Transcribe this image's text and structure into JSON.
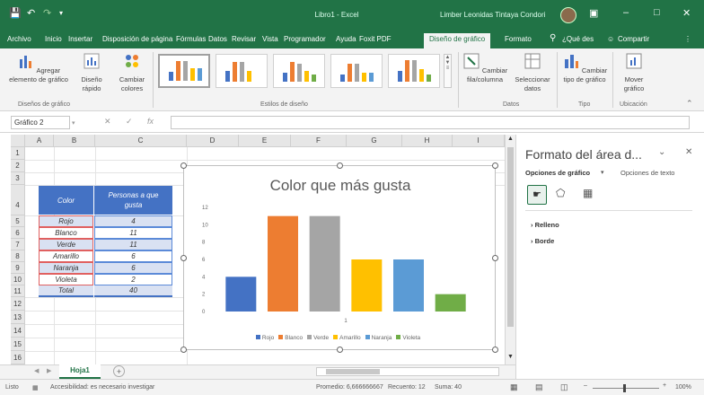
{
  "window": {
    "app_title": "Libro1 - Excel",
    "user_name": "Limber Leonidas Tintaya Condori",
    "minimize_icon": "minimize-icon",
    "restore_icon": "restore-icon",
    "close_icon": "close-icon"
  },
  "menu": {
    "items": [
      "Archivo",
      "Inicio",
      "Insertar",
      "Disposición de página",
      "Fórmulas",
      "Datos",
      "Revisar",
      "Vista",
      "Programador",
      "Ayuda",
      "Foxit PDF",
      "Diseño de gráfico",
      "Formato"
    ],
    "tell_me": "¿Qué des",
    "share": "Compartir"
  },
  "ribbon": {
    "add_element": "Agregar elemento de gráfico",
    "quick_layout": "Diseño rápido",
    "change_colors": "Cambiar colores",
    "group_layouts": "Diseños de gráfico",
    "group_styles": "Estilos de diseño",
    "switch_row_col": "Cambiar fila/columna",
    "select_data": "Seleccionar datos",
    "group_data": "Datos",
    "change_type": "Cambiar tipo de gráfico",
    "group_type": "Tipo",
    "move_chart": "Mover gráfico",
    "group_location": "Ubicación"
  },
  "formula_bar": {
    "name_box": "Gráfico 2",
    "cancel": "✕",
    "confirm": "✓",
    "fx": "fx"
  },
  "sheet": {
    "columns": [
      "A",
      "B",
      "C",
      "D",
      "E",
      "F",
      "G",
      "H",
      "I"
    ],
    "rows": [
      "1",
      "2",
      "3",
      "4",
      "5",
      "6",
      "7",
      "8",
      "9",
      "10",
      "11",
      "12",
      "13",
      "14",
      "15",
      "16"
    ],
    "table": {
      "header_color": "Color",
      "header_count": "Personas a que gusta",
      "rows": [
        {
          "label": "Rojo",
          "value": "4"
        },
        {
          "label": "Blanco",
          "value": "11"
        },
        {
          "label": "Verde",
          "value": "11"
        },
        {
          "label": "Amarillo",
          "value": "6"
        },
        {
          "label": "Naranja",
          "value": "6"
        },
        {
          "label": "Violeta",
          "value": "2"
        }
      ],
      "total_label": "Total",
      "total_value": "40"
    }
  },
  "chart_data": {
    "type": "bar",
    "title": "Color que más gusta",
    "categories": [
      "1"
    ],
    "series": [
      {
        "name": "Rojo",
        "values": [
          4
        ],
        "color": "#4472c4"
      },
      {
        "name": "Blanco",
        "values": [
          11
        ],
        "color": "#ed7d31"
      },
      {
        "name": "Verde",
        "values": [
          11
        ],
        "color": "#a5a5a5"
      },
      {
        "name": "Amarillo",
        "values": [
          6
        ],
        "color": "#ffc000"
      },
      {
        "name": "Naranja",
        "values": [
          6
        ],
        "color": "#5b9bd5"
      },
      {
        "name": "Violeta",
        "values": [
          2
        ],
        "color": "#70ad47"
      }
    ],
    "yticks": [
      "0",
      "2",
      "4",
      "6",
      "8",
      "10",
      "12"
    ],
    "ylim": [
      0,
      12
    ],
    "legend_position": "bottom",
    "grid": false
  },
  "format_pane": {
    "title": "Formato del área d...",
    "tab_chart": "Opciones de gráfico",
    "tab_text": "Opciones de texto",
    "sections": [
      "Relleno",
      "Borde"
    ]
  },
  "sheet_tabs": {
    "active": "Hoja1",
    "add": "+"
  },
  "status": {
    "mode": "Listo",
    "accessibility": "Accesibilidad: es necesario investigar",
    "average": "Promedio: 6,666666667",
    "count": "Recuento: 12",
    "sum": "Suma: 40",
    "zoom": "100%"
  },
  "colors": {
    "excel_green": "#217346",
    "table_header": "#4472c4",
    "table_body": "#d9e1f2"
  }
}
